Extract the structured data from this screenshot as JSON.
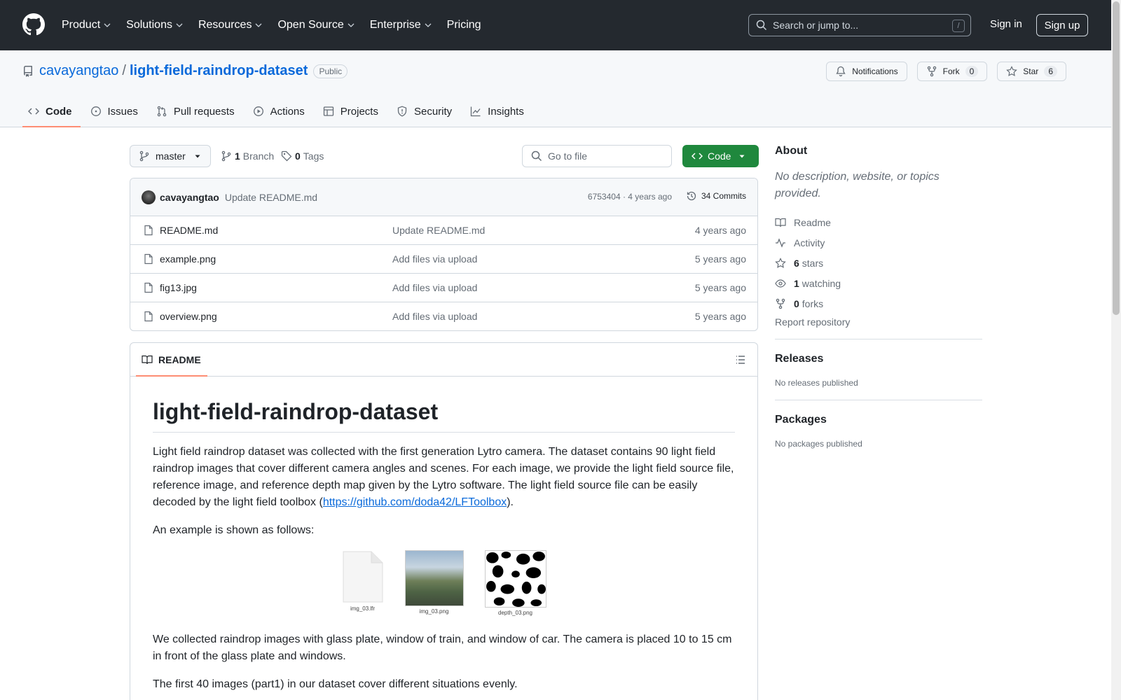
{
  "header": {
    "nav": [
      "Product",
      "Solutions",
      "Resources",
      "Open Source",
      "Enterprise",
      "Pricing"
    ],
    "search_placeholder": "Search or jump to...",
    "search_shortcut": "/",
    "signin": "Sign in",
    "signup": "Sign up"
  },
  "repo": {
    "owner": "cavayangtao",
    "separator": "/",
    "name": "light-field-raindrop-dataset",
    "visibility": "Public",
    "notifications_label": "Notifications",
    "fork_label": "Fork",
    "fork_count": "0",
    "star_label": "Star",
    "star_count": "6",
    "tabs": [
      "Code",
      "Issues",
      "Pull requests",
      "Actions",
      "Projects",
      "Security",
      "Insights"
    ]
  },
  "branchbar": {
    "branch": "master",
    "branch_count": "1",
    "branch_label": "Branch",
    "tag_count": "0",
    "tag_label": "Tags",
    "gofile_placeholder": "Go to file",
    "code_button": "Code"
  },
  "commit": {
    "author": "cavayangtao",
    "message": "Update README.md",
    "meta": "6753404 · 4 years ago",
    "commits": "34 Commits"
  },
  "files": [
    {
      "name": "README.md",
      "message": "Update README.md",
      "age": "4 years ago"
    },
    {
      "name": "example.png",
      "message": "Add files via upload",
      "age": "5 years ago"
    },
    {
      "name": "fig13.jpg",
      "message": "Add files via upload",
      "age": "5 years ago"
    },
    {
      "name": "overview.png",
      "message": "Add files via upload",
      "age": "5 years ago"
    }
  ],
  "readme": {
    "tab_label": "README",
    "title": "light-field-raindrop-dataset",
    "p1": "Light field raindrop dataset was collected with the first generation Lytro camera. The dataset contains 90 light field raindrop images that cover different camera angles and scenes. For each image, we provide the light field source file, reference image, and reference depth map given by the Lytro software. The light field source file can be easily decoded by the light field toolbox (",
    "p1_link": "https://github.com/doda42/LFToolbox",
    "p1_end": ").",
    "p2": "An example is shown as follows:",
    "captions": [
      "img_03.lfr",
      "img_03.png",
      "depth_03.png"
    ],
    "p3": "We collected raindrop images with glass plate, window of train, and window of car. The camera is placed 10 to 15 cm in front of the glass plate and windows.",
    "p4": "The first 40 images (part1) in our dataset cover different situations evenly."
  },
  "about": {
    "title": "About",
    "description": "No description, website, or topics provided.",
    "readme": "Readme",
    "activity": "Activity",
    "stars_count": "6",
    "stars_label": "stars",
    "watching_count": "1",
    "watching_label": "watching",
    "forks_count": "0",
    "forks_label": "forks",
    "report": "Report repository"
  },
  "releases": {
    "title": "Releases",
    "none": "No releases published"
  },
  "packages": {
    "title": "Packages",
    "none": "No packages published"
  }
}
